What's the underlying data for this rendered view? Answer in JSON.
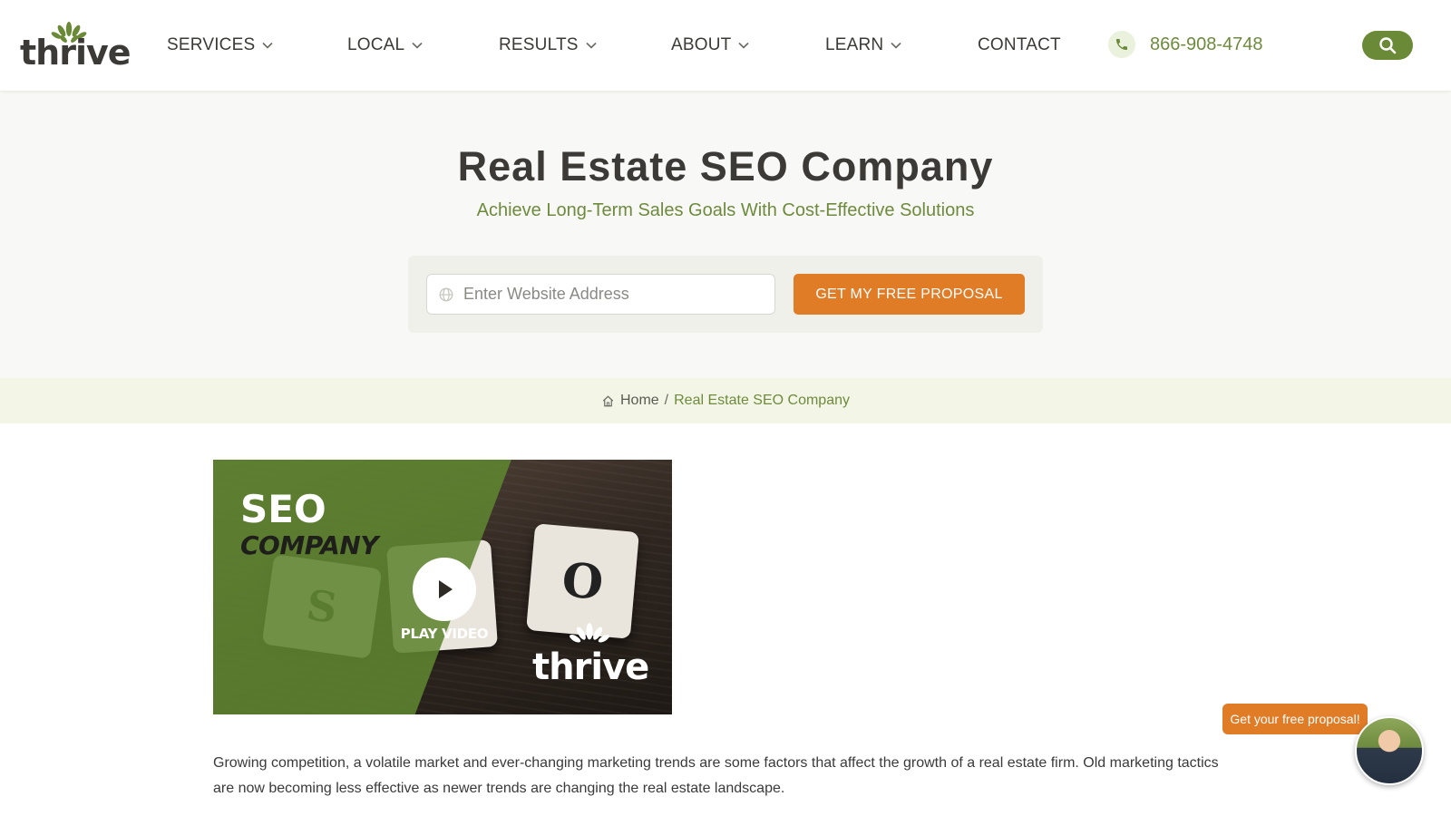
{
  "brand": {
    "logo_text": "thrive"
  },
  "nav": {
    "items": [
      {
        "label": "SERVICES",
        "has_dropdown": true
      },
      {
        "label": "LOCAL",
        "has_dropdown": true
      },
      {
        "label": "RESULTS",
        "has_dropdown": true
      },
      {
        "label": "ABOUT",
        "has_dropdown": true
      },
      {
        "label": "LEARN",
        "has_dropdown": true
      },
      {
        "label": "CONTACT",
        "has_dropdown": false
      }
    ],
    "phone": "866-908-4748"
  },
  "hero": {
    "title": "Real Estate SEO Company",
    "subtitle": "Achieve Long-Term Sales Goals With Cost-Effective Solutions",
    "input_placeholder": "Enter Website Address",
    "cta_label": "GET MY FREE PROPOSAL"
  },
  "breadcrumb": {
    "home": "Home",
    "separator": "/",
    "current": "Real Estate SEO Company"
  },
  "video": {
    "title_line1": "SEO",
    "title_line2": "COMPANY",
    "play_label": "PLAY VIDEO",
    "logo_text": "thrive"
  },
  "content": {
    "paragraph": "Growing competition, a volatile market and ever-changing marketing trends are some factors that affect the growth of a real estate firm. Old marketing tactics are now becoming less effective as newer trends are changing the real estate landscape."
  },
  "chat": {
    "bubble_label": "Get your free proposal!"
  },
  "colors": {
    "brand_green": "#6a8a37",
    "text_green": "#6e8b3d",
    "accent_orange": "#e07b26",
    "dark_text": "#3b3a36"
  }
}
